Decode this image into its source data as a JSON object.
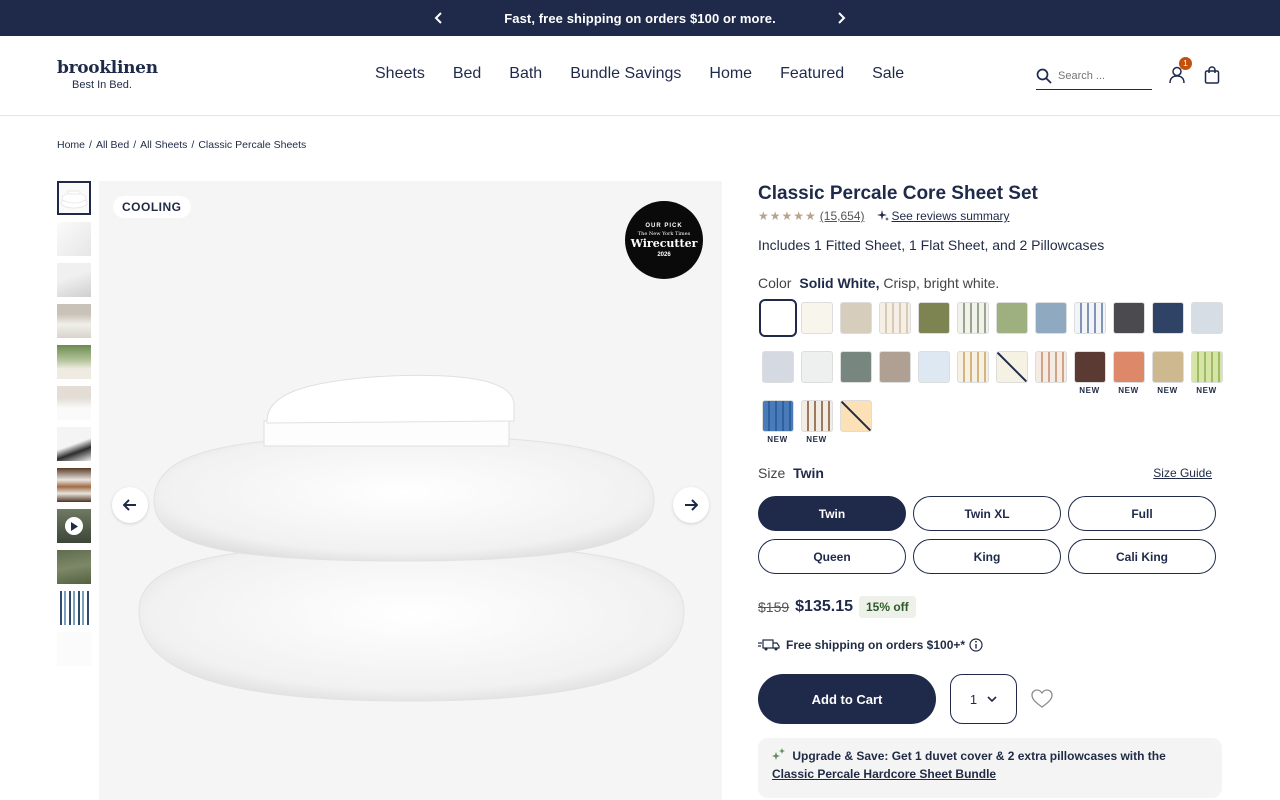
{
  "announcement": {
    "text": "Fast, free shipping on orders $100 or more."
  },
  "header": {
    "logo": "brooklinen",
    "tagline": "Best In Bed.",
    "nav": [
      "Sheets",
      "Bed",
      "Bath",
      "Bundle Savings",
      "Home",
      "Featured",
      "Sale"
    ],
    "search_placeholder": "Search ...",
    "cart_count": "1"
  },
  "breadcrumb": [
    "Home",
    "All Bed",
    "All Sheets",
    "Classic Percale Sheets"
  ],
  "gallery": {
    "badge": "COOLING",
    "award": {
      "line1": "OUR PICK",
      "line2": "The New York Times",
      "line3": "Wirecutter",
      "line4": "2026"
    }
  },
  "product": {
    "title": "Classic Percale Core Sheet Set",
    "rating_stars": "★★★★★",
    "review_count": "(15,654)",
    "reviews_summary": "See reviews summary",
    "includes": "Includes 1 Fitted Sheet, 1 Flat Sheet, and 2 Pillowcases",
    "color_label": "Color",
    "color_selected": "Solid White,",
    "color_desc": "Crisp, bright white.",
    "swatches": [
      {
        "name": "Solid White",
        "color": "#ffffff",
        "selected": true,
        "new": false
      },
      {
        "name": "Cream",
        "color": "#f8f5ec",
        "new": false
      },
      {
        "name": "Oat",
        "color": "#d6cdbd",
        "new": false
      },
      {
        "name": "Stripe Sand",
        "color": "stripe:#f5efe6:#d8cab4",
        "new": false
      },
      {
        "name": "Olive",
        "color": "#7d8451",
        "new": false
      },
      {
        "name": "Stripe Sage",
        "color": "stripe:#f1f2ec:#9aa58f",
        "new": false
      },
      {
        "name": "Sage",
        "color": "#9eaf80",
        "new": false
      },
      {
        "name": "Blue",
        "color": "#8fa9c1",
        "new": false
      },
      {
        "name": "Stripe Blue",
        "color": "stripe:#f2f4f8:#8094b6",
        "new": false
      },
      {
        "name": "Graphite",
        "color": "#4a4a4f",
        "new": false
      },
      {
        "name": "Navy",
        "color": "#2f4366",
        "new": false
      },
      {
        "name": "Light Blue",
        "color": "#d6dde5",
        "new": false
      },
      {
        "name": "Mist",
        "color": "#d4d9e2",
        "new": false
      },
      {
        "name": "Fog",
        "color": "#eef0f0",
        "new": false
      },
      {
        "name": "Slate Green",
        "color": "#77867f",
        "new": false
      },
      {
        "name": "Taupe",
        "color": "#b0a093",
        "new": false
      },
      {
        "name": "Pale Blue",
        "color": "#dde8f2",
        "new": false
      },
      {
        "name": "Stripe Gold",
        "color": "stripe:#f6f1e4:#d5b67a",
        "new": false
      },
      {
        "name": "Lemon Print",
        "color": "#f5f2e4",
        "slash": true,
        "new": false
      },
      {
        "name": "Stripe Terracotta",
        "color": "stripe:#f4ebe2:#d3a389",
        "new": false
      },
      {
        "name": "Chocolate",
        "color": "#5a3a33",
        "new": true
      },
      {
        "name": "Coral",
        "color": "#dd8868",
        "new": true
      },
      {
        "name": "Leopard",
        "color": "#cdb88f",
        "new": true
      },
      {
        "name": "Stripe Lime",
        "color": "stripe:#d7e4a6:#9cbc65",
        "new": true
      },
      {
        "name": "Stripe Cobalt",
        "color": "stripe:#4a7bb9:#2f5f9e",
        "new": true
      },
      {
        "name": "Stripe Cocoa",
        "color": "stripe:#f3ece4:#9b7a62",
        "new": true
      },
      {
        "name": "Butter",
        "color": "#fbe1b5",
        "slash": true,
        "new": false
      }
    ],
    "new_label": "NEW",
    "size_label": "Size",
    "size_selected": "Twin",
    "size_guide": "Size Guide",
    "sizes": [
      "Twin",
      "Twin XL",
      "Full",
      "Queen",
      "King",
      "Cali King"
    ],
    "old_price": "$159",
    "price": "$135.15",
    "discount": "15% off",
    "shipping": "Free shipping on orders $100+*",
    "add_to_cart": "Add to Cart",
    "quantity": "1",
    "upgrade_text": "Upgrade & Save: Get 1 duvet cover & 2 extra pillowcases with the ",
    "upgrade_link": "Classic Percale Hardcore Sheet Bundle"
  }
}
